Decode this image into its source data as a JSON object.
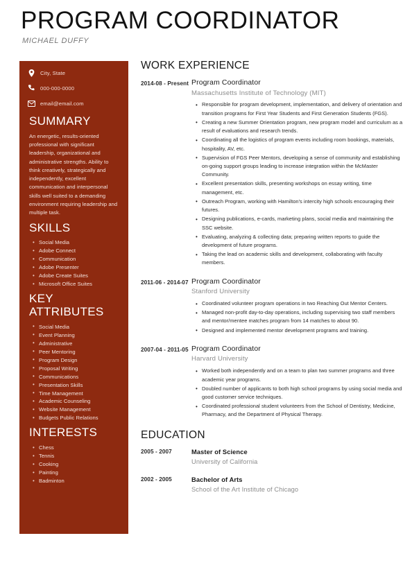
{
  "header": {
    "title": "PROGRAM COORDINATOR",
    "name": "MICHAEL DUFFY"
  },
  "colors": {
    "sidebar_bg": "#8e2a10",
    "sidebar_text": "#f4e2dd",
    "heading_text": "#1a1a1a",
    "muted_text": "#8c8c8c"
  },
  "sidebar": {
    "contact": [
      {
        "icon": "map-pin-icon",
        "text": "City, State"
      },
      {
        "icon": "phone-icon",
        "text": "000-000-0000"
      },
      {
        "icon": "envelope-icon",
        "text": "email@email.com"
      }
    ],
    "summary": {
      "heading": "SUMMARY",
      "text": "An energetic, results-oriented professional with significant leadership, organizational and administrative strengths. Ability to think creatively, strategically and independently, excellent communication and interpersonal skills well suited to a demanding environment requiring leadership and multiple task."
    },
    "skills": {
      "heading": "SKILLS",
      "items": [
        "Social Media",
        "Adobe Connect",
        "Communication",
        "Adobe Presenter",
        "Adobe Create Suites",
        "Microsoft Office Suites"
      ]
    },
    "key_attributes": {
      "heading": "KEY ATTRIBUTES",
      "items": [
        "Social Media",
        "Event Planning",
        "Administrative",
        "Peer Mentoring",
        "Program Design",
        "Proposal Writing",
        "Communications",
        "Presentation Skills",
        "Time Management",
        "Academic Counseling",
        "Website Management",
        "Budgets Public Relations"
      ]
    },
    "interests": {
      "heading": "INTERESTS",
      "items": [
        "Chess",
        "Tennis",
        "Cooking",
        "Painting",
        "Badminton"
      ]
    }
  },
  "main": {
    "work_heading": "WORK EXPERIENCE",
    "jobs": [
      {
        "dates": "2014-08 - Present",
        "role": "Program Coordinator",
        "org": "Massachusetts Institute of Technology (MIT)",
        "bullets": [
          "Responsible for program development, implementation, and delivery of orientation and transition programs for First Year Students and First Generation Students (FGS).",
          "Creating a new Summer Orientation program, new program model and curriculum as a result of evaluations and research trends.",
          "Coordinating all the logistics of program events including room bookings, materials, hospitality, AV, etc.",
          "Supervision of FGS Peer Mentors, developing a sense of community and establishing on-going support groups leading to increase integration within the McMaster Community.",
          "Excellent presentation skills, presenting workshops on essay writing, time management, etc.",
          "Outreach Program, working with Hamilton's intercity high schools encouraging their futures.",
          "Designing publications, e-cards, marketing plans, social media and maintaining the SSC website.",
          "Evaluating, analyzing & collecting data; preparing written reports to guide the development of future programs.",
          "Taking the lead on academic skills and development, collaborating with faculty members."
        ]
      },
      {
        "dates": "2011-06 - 2014-07",
        "role": "Program Coordinator",
        "org": "Stanford University",
        "bullets": [
          "Coordinated volunteer program operations in two Reaching Out Mentor Centers.",
          "Managed non-profit day-to-day operations, including supervising two staff members and mentor/mentee matches program from 14 matches to about 90.",
          "Designed and implemented mentor development programs and training."
        ]
      },
      {
        "dates": "2007-04 - 2011-05",
        "role": "Program Coordinator",
        "org": "Harvard University",
        "bullets": [
          "Worked both independently and on a team to plan two summer programs and three academic year programs.",
          "Doubled number of applicants to both high school programs by using social media and good customer service techniques.",
          "Coordinated professional student volunteers from the School of Dentistry, Medicine, Pharmacy, and the Department of Physical Therapy."
        ]
      }
    ],
    "education_heading": "EDUCATION",
    "education": [
      {
        "dates": "2005 - 2007",
        "degree": "Master of Science",
        "school": "University of California"
      },
      {
        "dates": "2002 - 2005",
        "degree": "Bachelor of Arts",
        "school": "School of the Art Institute of Chicago"
      }
    ]
  }
}
